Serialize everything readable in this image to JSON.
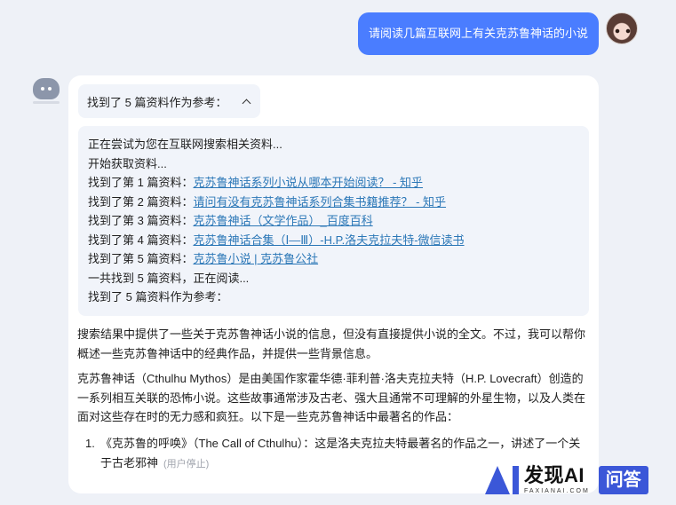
{
  "user_message": "请阅读几篇互联网上有关克苏鲁神话的小说",
  "search_toggle_label": "找到了 5 篇资料作为参考：",
  "search_log": {
    "line1": "正在尝试为您在互联网搜索相关资料...",
    "line2": "开始获取资料...",
    "results": [
      {
        "prefix": "找到了第 1 篇资料：",
        "link": "克苏鲁神话系列小说从哪本开始阅读？ - 知乎"
      },
      {
        "prefix": "找到了第 2 篇资料：",
        "link": "请问有没有克苏鲁神话系列合集书籍推荐？ - 知乎"
      },
      {
        "prefix": "找到了第 3 篇资料：",
        "link": "克苏鲁神话（文学作品）_百度百科"
      },
      {
        "prefix": "找到了第 4 篇资料：",
        "link": "克苏鲁神话合集（Ⅰ—Ⅲ）-H.P.洛夫克拉夫特-微信读书"
      },
      {
        "prefix": "找到了第 5 篇资料：",
        "link": "克苏鲁小说 | 克苏鲁公社"
      }
    ],
    "line_summary": "一共找到 5 篇资料，正在阅读...",
    "line_final": "找到了 5 篇资料作为参考："
  },
  "answer": {
    "para1": "搜索结果中提供了一些关于克苏鲁神话小说的信息，但没有直接提供小说的全文。不过，我可以帮你概述一些克苏鲁神话中的经典作品，并提供一些背景信息。",
    "para2": "克苏鲁神话（Cthulhu Mythos）是由美国作家霍华德·菲利普·洛夫克拉夫特（H.P. Lovecraft）创造的一系列相互关联的恐怖小说。这些故事通常涉及古老、强大且通常不可理解的外星生物，以及人类在面对这些存在时的无力感和疯狂。以下是一些克苏鲁神话中最著名的作品：",
    "list_number": "1.",
    "list_item1": "《克苏鲁的呼唤》（The Call of Cthulhu）：这是洛夫克拉夫特最著名的作品之一，讲述了一个关于古老邪神",
    "stopped_label": "(用户停止)"
  },
  "watermark": {
    "main": "发现AI",
    "sub": "FAXIANAI.COM",
    "badge": "问答"
  },
  "icons": {
    "bot": "robot-avatar-icon",
    "user": "user-avatar-icon",
    "toggle": "chevron-up-icon",
    "logo": "ai-logo-icon"
  },
  "colors": {
    "user_bubble": "#4a7dff",
    "link": "#2b77b7",
    "background": "#eef1f7",
    "brand": "#3b57d8"
  }
}
